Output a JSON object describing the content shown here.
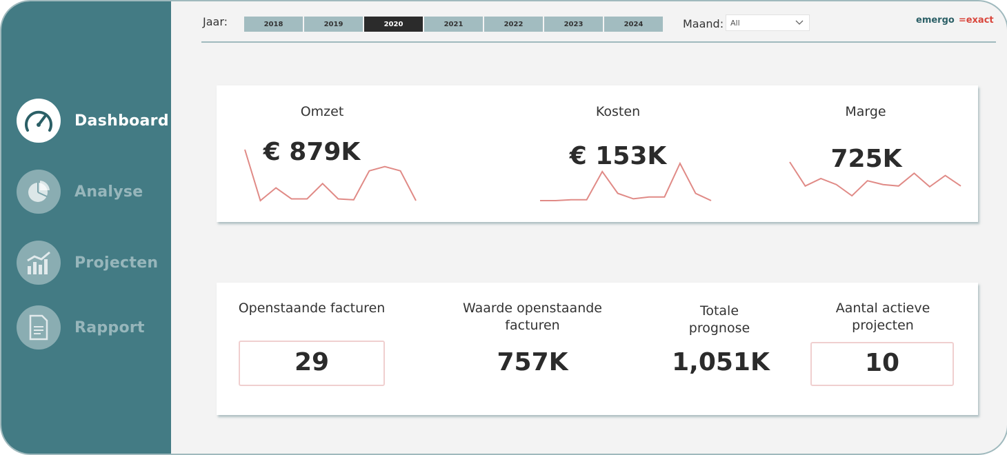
{
  "sidebar": {
    "items": [
      {
        "label": "Dashboard",
        "icon": "speedometer-icon",
        "active": true
      },
      {
        "label": "Analyse",
        "icon": "pie-chart-icon",
        "active": false
      },
      {
        "label": "Projecten",
        "icon": "bar-chart-icon",
        "active": false
      },
      {
        "label": "Rapport",
        "icon": "document-icon",
        "active": false
      }
    ]
  },
  "filters": {
    "year_label": "Jaar:",
    "years": [
      "2018",
      "2019",
      "2020",
      "2021",
      "2022",
      "2023",
      "2024"
    ],
    "selected_year": "2020",
    "month_label": "Maand:",
    "month_value": "All"
  },
  "logo": {
    "part1": "emergo",
    "part2": "=exact"
  },
  "kpis": [
    {
      "title": "Omzet",
      "value": "€ 879K"
    },
    {
      "title": "Kosten",
      "value": "€ 153K"
    },
    {
      "title": "Marge",
      "value": "725K"
    }
  ],
  "summary": [
    {
      "title": "Openstaande facturen",
      "value": "29"
    },
    {
      "title": "Waarde openstaande facturen",
      "value": "757K"
    },
    {
      "title": "Totale prognose",
      "value": "1,051K"
    },
    {
      "title": "Aantal actieve projecten",
      "value": "10"
    }
  ],
  "colors": {
    "sidebar": "#437b84",
    "accent_line": "#e08a86",
    "selected_year": "#2b2b2b",
    "year_button": "#a2bcc0"
  },
  "chart_data": [
    {
      "type": "line",
      "name": "Omzet",
      "values": [
        70,
        10,
        25,
        12,
        12,
        30,
        12,
        11,
        45,
        50,
        45,
        10
      ]
    },
    {
      "type": "line",
      "name": "Kosten",
      "values": [
        6,
        6,
        7,
        7,
        38,
        14,
        8,
        10,
        10,
        47,
        14,
        6
      ]
    },
    {
      "type": "line",
      "name": "Marge",
      "values": [
        60,
        28,
        38,
        30,
        15,
        35,
        30,
        28,
        45,
        27,
        42,
        28
      ]
    }
  ]
}
